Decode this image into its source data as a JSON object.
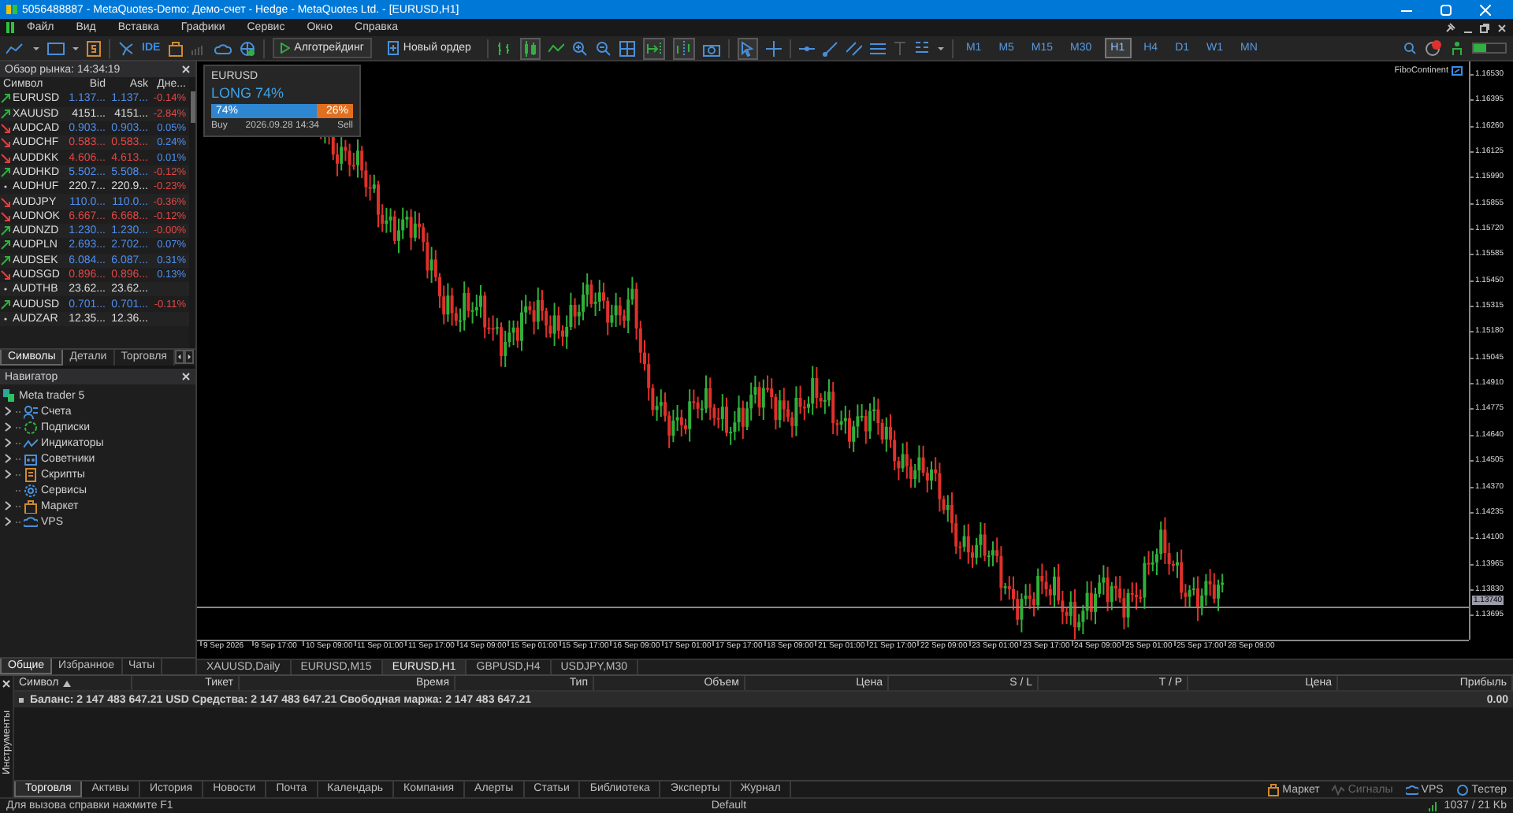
{
  "window": {
    "title": "5056488887 - MetaQuotes-Demo: Демо-счет - Hedge - MetaQuotes Ltd. - [EURUSD,H1]"
  },
  "menu": [
    "Файл",
    "Вид",
    "Вставка",
    "Графики",
    "Сервис",
    "Окно",
    "Справка"
  ],
  "toolbar": {
    "ide": "IDE",
    "algo_button": "Алготрейдинг",
    "order_button": "Новый ордер",
    "timeframes": [
      {
        "label": "M1",
        "selected": false
      },
      {
        "label": "M5",
        "selected": false
      },
      {
        "label": "M15",
        "selected": false
      },
      {
        "label": "M30",
        "selected": false
      },
      {
        "label": "H1",
        "selected": true
      },
      {
        "label": "H4",
        "selected": false
      },
      {
        "label": "D1",
        "selected": false
      },
      {
        "label": "W1",
        "selected": false
      },
      {
        "label": "MN",
        "selected": false
      }
    ]
  },
  "market_watch": {
    "title": "Обзор рынка: 14:34:19",
    "columns": [
      "Символ",
      "Bid",
      "Ask",
      "Дне..."
    ],
    "rows": [
      {
        "symbol": "EURUSD",
        "kind": "up",
        "color": "#4f8fef",
        "bid": "1.137...",
        "ask": "1.137...",
        "change": "-0.14%",
        "change_falling": true
      },
      {
        "symbol": "XAUUSD",
        "kind": "up",
        "color": "#dddddd",
        "bid": "4151...",
        "ask": "4151...",
        "change": "-2.84%",
        "change_falling": true
      },
      {
        "symbol": "AUDCAD",
        "kind": "down",
        "color": "#4f8fef",
        "bid": "0.903...",
        "ask": "0.903...",
        "change": "0.05%",
        "change_falling": false
      },
      {
        "symbol": "AUDCHF",
        "kind": "down",
        "color": "#e04848",
        "bid": "0.583...",
        "ask": "0.583...",
        "change": "0.24%",
        "change_falling": false
      },
      {
        "symbol": "AUDDKK",
        "kind": "down",
        "color": "#e04848",
        "bid": "4.606...",
        "ask": "4.613...",
        "change": "0.01%",
        "change_falling": false
      },
      {
        "symbol": "AUDHKD",
        "kind": "up",
        "color": "#4f8fef",
        "bid": "5.502...",
        "ask": "5.508...",
        "change": "-0.12%",
        "change_falling": true
      },
      {
        "symbol": "AUDHUF",
        "kind": "flat",
        "color": "#dddddd",
        "bid": "220.7...",
        "ask": "220.9...",
        "change": "-0.23%",
        "change_falling": true
      },
      {
        "symbol": "AUDJPY",
        "kind": "down",
        "color": "#4f8fef",
        "bid": "110.0...",
        "ask": "110.0...",
        "change": "-0.36%",
        "change_falling": true
      },
      {
        "symbol": "AUDNOK",
        "kind": "down",
        "color": "#e04848",
        "bid": "6.667...",
        "ask": "6.668...",
        "change": "-0.12%",
        "change_falling": true
      },
      {
        "symbol": "AUDNZD",
        "kind": "up",
        "color": "#4f8fef",
        "bid": "1.230...",
        "ask": "1.230...",
        "change": "-0.00%",
        "change_falling": true
      },
      {
        "symbol": "AUDPLN",
        "kind": "up",
        "color": "#4f8fef",
        "bid": "2.693...",
        "ask": "2.702...",
        "change": "0.07%",
        "change_falling": false
      },
      {
        "symbol": "AUDSEK",
        "kind": "up",
        "color": "#4f8fef",
        "bid": "6.084...",
        "ask": "6.087...",
        "change": "0.31%",
        "change_falling": false
      },
      {
        "symbol": "AUDSGD",
        "kind": "down",
        "color": "#e04848",
        "bid": "0.896...",
        "ask": "0.896...",
        "change": "0.13%",
        "change_falling": false
      },
      {
        "symbol": "AUDTHB",
        "kind": "flat",
        "color": "#dddddd",
        "bid": "23.62...",
        "ask": "23.62..."
      },
      {
        "symbol": "AUDUSD",
        "kind": "up",
        "color": "#4f8fef",
        "bid": "0.701...",
        "ask": "0.701...",
        "change": "-0.11%",
        "change_falling": true
      },
      {
        "symbol": "AUDZAR",
        "kind": "flat",
        "color": "#dddddd",
        "bid": "12.35...",
        "ask": "12.36..."
      }
    ],
    "tabs": [
      {
        "label": "Символы",
        "selected": true
      },
      {
        "label": "Детали",
        "selected": false
      },
      {
        "label": "Торговля",
        "selected": false
      }
    ]
  },
  "navigator": {
    "title": "Навигатор",
    "root": {
      "label": "Meta trader 5",
      "children": [
        {
          "label": "Счета",
          "kind": "accounts",
          "expandable": true
        },
        {
          "label": "Подписки",
          "kind": "subscriptions",
          "expandable": true
        },
        {
          "label": "Индикаторы",
          "kind": "indicators",
          "expandable": true
        },
        {
          "label": "Советники",
          "kind": "experts",
          "expandable": true
        },
        {
          "label": "Скрипты",
          "kind": "scripts",
          "expandable": true
        },
        {
          "label": "Сервисы",
          "kind": "services",
          "expandable": false
        },
        {
          "label": "Маркет",
          "kind": "market",
          "expandable": true
        },
        {
          "label": "VPS",
          "kind": "vps",
          "expandable": true
        }
      ]
    },
    "tabs": [
      {
        "label": "Общие",
        "selected": true
      },
      {
        "label": "Избранное",
        "selected": false
      },
      {
        "label": "Чаты",
        "selected": false
      }
    ]
  },
  "chart": {
    "widget": {
      "symbol": "EURUSD",
      "signal": "LONG 74%",
      "level": 0.74,
      "buy_share": "74%",
      "sell_share": "26%",
      "buy": "Buy",
      "time": "2026.09.28 14:34",
      "sell": "Sell"
    },
    "expert": "FiboContinent",
    "price_labels": [
      "1.16530",
      "1.16395",
      "1.16260",
      "1.16125",
      "1.15990",
      "1.15855",
      "1.15720",
      "1.15585",
      "1.15450",
      "1.15315",
      "1.15180",
      "1.15045",
      "1.14910",
      "1.14775",
      "1.14640",
      "1.14505",
      "1.14370",
      "1.14235",
      "1.14100",
      "1.13965",
      "1.13830",
      "1.13695"
    ],
    "current_price": "1.13740",
    "time_labels": [
      "9 Sep 2026",
      "9 Sep 17:00",
      "10 Sep 09:00",
      "11 Sep 01:00",
      "11 Sep 17:00",
      "14 Sep 09:00",
      "15 Sep 01:00",
      "15 Sep 17:00",
      "16 Sep 09:00",
      "17 Sep 01:00",
      "17 Sep 17:00",
      "18 Sep 09:00",
      "21 Sep 01:00",
      "21 Sep 17:00",
      "22 Sep 09:00",
      "23 Sep 01:00",
      "23 Sep 17:00",
      "24 Sep 09:00",
      "25 Sep 01:00",
      "25 Sep 17:00",
      "28 Sep 09:00"
    ],
    "tabs": [
      {
        "label": "XAUUSD,Daily",
        "selected": false
      },
      {
        "label": "EURUSD,M15",
        "selected": false
      },
      {
        "label": "EURUSD,H1",
        "selected": true
      },
      {
        "label": "GBPUSD,H4",
        "selected": false
      },
      {
        "label": "USDJPY,M30",
        "selected": false
      }
    ]
  },
  "toolbox": {
    "side_label": "Инструменты",
    "columns": [
      {
        "label": "Символ",
        "sorted": true
      },
      {
        "label": "Тикет",
        "sorted": false
      },
      {
        "label": "Время",
        "sorted": false
      },
      {
        "label": "Тип",
        "sorted": false
      },
      {
        "label": "Объем",
        "sorted": false
      },
      {
        "label": "Цена",
        "sorted": false
      },
      {
        "label": "S / L",
        "sorted": false
      },
      {
        "label": "T / P",
        "sorted": false
      },
      {
        "label": "Цена",
        "sorted": false
      },
      {
        "label": "Прибыль",
        "sorted": false
      }
    ],
    "balance": "Баланс: 2 147 483 647.21 USD  Средства: 2 147 483 647.21  Свободная маржа: 2 147 483 647.21",
    "profit": "0.00",
    "tabs": [
      {
        "label": "Торговля",
        "selected": true
      },
      {
        "label": "Активы",
        "selected": false
      },
      {
        "label": "История",
        "selected": false
      },
      {
        "label": "Новости",
        "selected": false
      },
      {
        "label": "Почта",
        "selected": false
      },
      {
        "label": "Календарь",
        "selected": false
      },
      {
        "label": "Компания",
        "selected": false
      },
      {
        "label": "Алерты",
        "selected": false
      },
      {
        "label": "Статьи",
        "selected": false
      },
      {
        "label": "Библиотека",
        "selected": false
      },
      {
        "label": "Эксперты",
        "selected": false
      },
      {
        "label": "Журнал",
        "selected": false
      }
    ],
    "links": [
      {
        "label": "Маркет",
        "kind": "market"
      },
      {
        "label": "Сигналы",
        "kind": "signals"
      },
      {
        "label": "VPS",
        "kind": "vps"
      },
      {
        "label": "Тестер",
        "kind": "tester"
      }
    ]
  },
  "status_bar": {
    "help": "Для вызова справки нажмите F1",
    "profile": "Default",
    "traffic": "1037 / 21 Kb"
  }
}
